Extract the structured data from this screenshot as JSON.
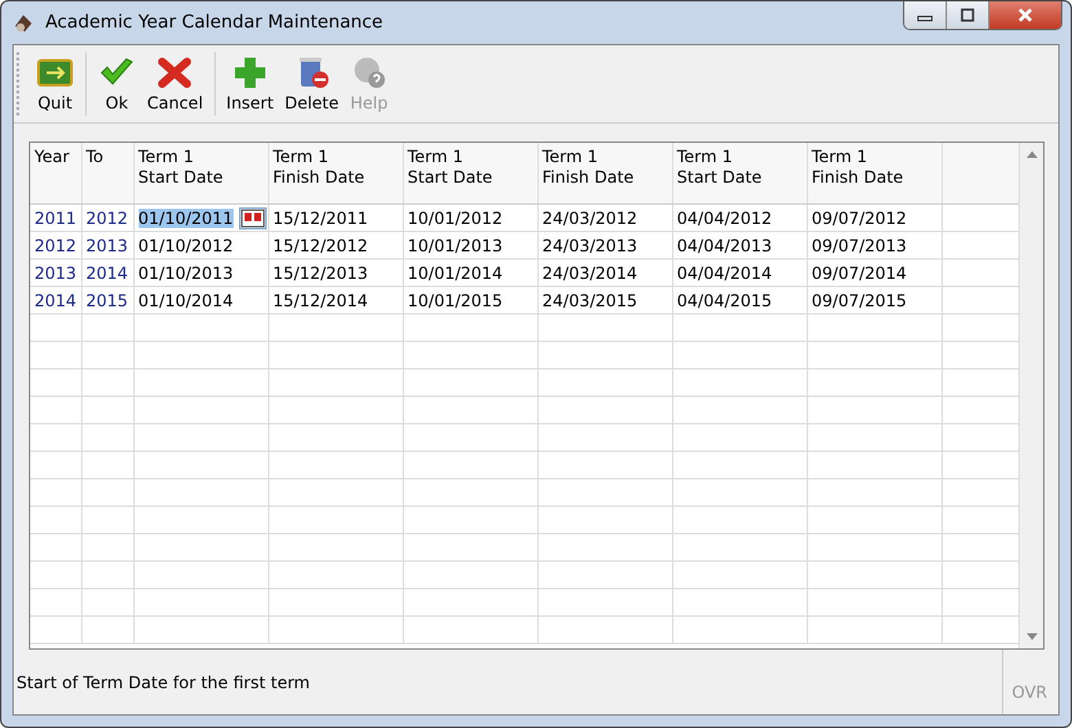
{
  "window": {
    "title": "Academic Year Calendar Maintenance"
  },
  "toolbar": [
    {
      "label": "Quit",
      "kind": "quit",
      "disabled": false
    },
    {
      "label": "Ok",
      "kind": "ok",
      "disabled": false
    },
    {
      "label": "Cancel",
      "kind": "cancel",
      "disabled": false
    },
    {
      "label": "Insert",
      "kind": "insert",
      "disabled": false
    },
    {
      "label": "Delete",
      "kind": "delete",
      "disabled": false
    },
    {
      "label": "Help",
      "kind": "help",
      "disabled": true
    }
  ],
  "table": {
    "columns": [
      {
        "line1": "Year",
        "kind": "key"
      },
      {
        "line1": "To",
        "kind": "key"
      },
      {
        "line1": "Term 1",
        "line2": "Start Date",
        "kind": "date"
      },
      {
        "line1": "Term 1",
        "line2": "Finish Date",
        "kind": "date"
      },
      {
        "line1": "Term 1",
        "line2": "Start Date",
        "kind": "date"
      },
      {
        "line1": "Term 1",
        "line2": "Finish Date",
        "kind": "date"
      },
      {
        "line1": "Term 1",
        "line2": "Start Date",
        "kind": "date"
      },
      {
        "line1": "Term 1",
        "line2": "Finish Date",
        "kind": "date"
      }
    ],
    "rows": [
      {
        "cells": [
          {
            "text": "2011",
            "selected": false
          },
          {
            "text": "2012",
            "selected": false
          },
          {
            "text": "01/10/2011",
            "selected": true
          },
          {
            "text": "15/12/2011",
            "selected": false
          },
          {
            "text": "10/01/2012",
            "selected": false
          },
          {
            "text": "24/03/2012",
            "selected": false
          },
          {
            "text": "04/04/2012",
            "selected": false
          },
          {
            "text": "09/07/2012",
            "selected": false
          }
        ]
      },
      {
        "cells": [
          {
            "text": "2012",
            "selected": false
          },
          {
            "text": "2013",
            "selected": false
          },
          {
            "text": "01/10/2012",
            "selected": false
          },
          {
            "text": "15/12/2012",
            "selected": false
          },
          {
            "text": "10/01/2013",
            "selected": false
          },
          {
            "text": "24/03/2013",
            "selected": false
          },
          {
            "text": "04/04/2013",
            "selected": false
          },
          {
            "text": "09/07/2013",
            "selected": false
          }
        ]
      },
      {
        "cells": [
          {
            "text": "2013",
            "selected": false
          },
          {
            "text": "2014",
            "selected": false
          },
          {
            "text": "01/10/2013",
            "selected": false
          },
          {
            "text": "15/12/2013",
            "selected": false
          },
          {
            "text": "10/01/2014",
            "selected": false
          },
          {
            "text": "24/03/2014",
            "selected": false
          },
          {
            "text": "04/04/2014",
            "selected": false
          },
          {
            "text": "09/07/2014",
            "selected": false
          }
        ]
      },
      {
        "cells": [
          {
            "text": "2014",
            "selected": false
          },
          {
            "text": "2015",
            "selected": false
          },
          {
            "text": "01/10/2014",
            "selected": false
          },
          {
            "text": "15/12/2014",
            "selected": false
          },
          {
            "text": "10/01/2015",
            "selected": false
          },
          {
            "text": "24/03/2015",
            "selected": false
          },
          {
            "text": "04/04/2015",
            "selected": false
          },
          {
            "text": "09/07/2015",
            "selected": false
          }
        ]
      }
    ]
  },
  "status_bar": {
    "message": "Start of Term Date for the first term",
    "mode": "OVR"
  }
}
